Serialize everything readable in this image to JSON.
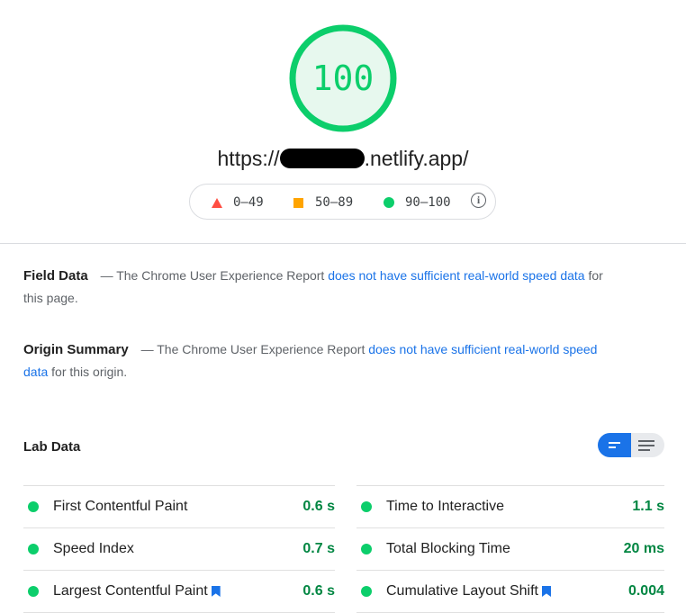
{
  "score": {
    "value": "100",
    "color": "#0cce6b"
  },
  "url": {
    "prefix": "https://",
    "redacted": "",
    "suffix": ".netlify.app/"
  },
  "legend": {
    "items": [
      {
        "label": "0–49",
        "icon": "red-triangle-icon",
        "color": "#ff4e42"
      },
      {
        "label": "50–89",
        "icon": "orange-square-icon",
        "color": "#ffa400"
      },
      {
        "label": "90–100",
        "icon": "green-circle-icon",
        "color": "#0cce6b"
      }
    ],
    "info_glyph": "i"
  },
  "field_data": {
    "title": "Field Data",
    "dash": "—",
    "text_before": "The Chrome User Experience Report",
    "link": "does not have sufficient real-world speed data",
    "text_after": "for this page."
  },
  "origin_summary": {
    "title": "Origin Summary",
    "dash": "—",
    "text_before": "The Chrome User Experience Report",
    "link": "does not have sufficient real-world speed data",
    "text_after": "for this origin."
  },
  "lab_data": {
    "title": "Lab Data",
    "view_toggle": {
      "selected": "compact",
      "options": [
        "compact",
        "expanded"
      ]
    },
    "metrics_left": [
      {
        "label": "First Contentful Paint",
        "value": "0.6 s",
        "bookmark": false
      },
      {
        "label": "Speed Index",
        "value": "0.7 s",
        "bookmark": false
      },
      {
        "label": "Largest Contentful Paint",
        "value": "0.6 s",
        "bookmark": true
      }
    ],
    "metrics_right": [
      {
        "label": "Time to Interactive",
        "value": "1.1 s",
        "bookmark": false
      },
      {
        "label": "Total Blocking Time",
        "value": "20 ms",
        "bookmark": false
      },
      {
        "label": "Cumulative Layout Shift",
        "value": "0.004",
        "bookmark": true
      }
    ]
  },
  "colors": {
    "pass": "#0cce6b",
    "pass_text": "#018642",
    "link": "#1a73e8"
  }
}
